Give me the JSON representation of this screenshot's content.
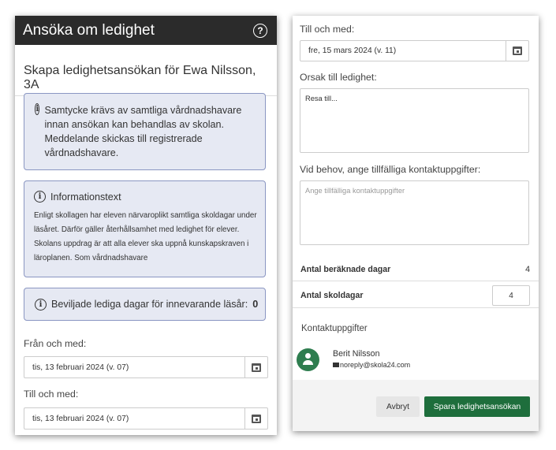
{
  "left": {
    "title": "Ansöka om ledighet",
    "help_icon": "?",
    "page_title": "Skapa ledighetsansökan för Ewa Nilsson, 3A",
    "consent_text": "Samtycke krävs av samtliga vårdnadshavare innan ansökan kan behandlas av skolan. Meddelande skickas till registrerade vårdnadshavare.",
    "info_heading": "Informationstext",
    "info_body": "Enligt skollagen har eleven närvaroplikt samtliga skoldagar under läsåret. Därför gäller återhållsamhet med ledighet för elever. Skolans uppdrag är att alla elever ska uppnå kunskapskraven i läroplanen. Som vårdnadshavare",
    "granted_label": "Beviljade lediga dagar för innevarande läsår:",
    "granted_value": "0",
    "from_label": "Från och med:",
    "from_value": "tis, 13 februari 2024 (v. 07)",
    "to_label": "Till och med:",
    "to_value": "tis, 13 februari 2024 (v. 07)"
  },
  "right": {
    "to_label": "Till och med:",
    "to_value": "fre, 15 mars 2024 (v. 11)",
    "reason_label": "Orsak till ledighet:",
    "reason_value": "Resa till...",
    "contact_label": "Vid behov, ange tillfälliga kontaktuppgifter:",
    "contact_placeholder": "Ange tillfälliga kontaktuppgifter",
    "calc_days_label": "Antal beräknade dagar",
    "calc_days_value": "4",
    "school_days_label": "Antal skoldagar",
    "school_days_value": "4",
    "contacts_heading": "Kontaktuppgifter",
    "contact_name": "Berit Nilsson",
    "contact_email": "noreply@skola24.com",
    "cancel_label": "Avbryt",
    "save_label": "Spara ledighetsansökan"
  },
  "colors": {
    "header_bg": "#2b2b2b",
    "info_bg": "#e6e9f3",
    "info_border": "#8a96c2",
    "primary": "#1e6e3c",
    "avatar": "#2e7d4f"
  },
  "icons": [
    "help-icon",
    "info-icon",
    "calendar-icon",
    "person-icon",
    "mail-icon"
  ]
}
